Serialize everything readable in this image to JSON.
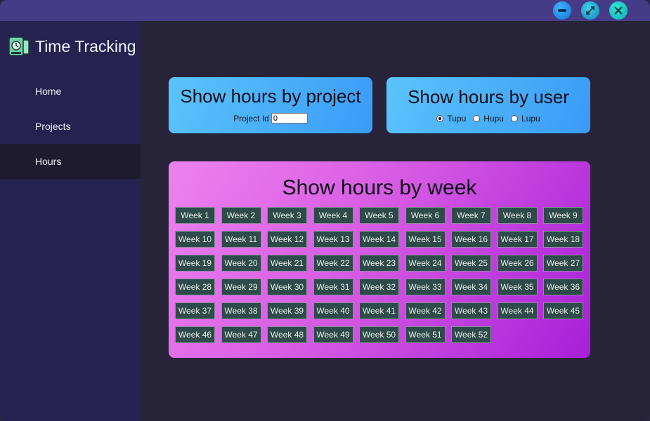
{
  "app": {
    "title": "Time Tracking",
    "icon": "time-tracking-logo-icon"
  },
  "window_controls": {
    "minimize_icon": "minimize-icon",
    "maximize_icon": "maximize-icon",
    "close_icon": "close-icon"
  },
  "sidebar": {
    "items": [
      {
        "label": "Home",
        "active": false
      },
      {
        "label": "Projects",
        "active": false
      },
      {
        "label": "Hours",
        "active": true
      }
    ]
  },
  "project_card": {
    "title": "Show hours by project",
    "input_label": "Project Id",
    "input_value": "0"
  },
  "user_card": {
    "title": "Show hours by user",
    "options": [
      {
        "label": "Tupu",
        "checked": true
      },
      {
        "label": "Hupu",
        "checked": false
      },
      {
        "label": "Lupu",
        "checked": false
      }
    ]
  },
  "week_card": {
    "title": "Show hours by week",
    "weeks": [
      "Week 1",
      "Week 2",
      "Week 3",
      "Week 4",
      "Week 5",
      "Week 6",
      "Week 7",
      "Week 8",
      "Week 9",
      "Week 10",
      "Week 11",
      "Week 12",
      "Week 13",
      "Week 14",
      "Week 15",
      "Week 16",
      "Week 17",
      "Week 18",
      "Week 19",
      "Week 20",
      "Week 21",
      "Week 22",
      "Week 23",
      "Week 24",
      "Week 25",
      "Week 26",
      "Week 27",
      "Week 28",
      "Week 29",
      "Week 30",
      "Week 31",
      "Week 32",
      "Week 33",
      "Week 34",
      "Week 35",
      "Week 36",
      "Week 37",
      "Week 38",
      "Week 39",
      "Week 40",
      "Week 41",
      "Week 42",
      "Week 43",
      "Week 44",
      "Week 45",
      "Week 46",
      "Week 47",
      "Week 48",
      "Week 49",
      "Week 50",
      "Week 51",
      "Week 52"
    ]
  },
  "colors": {
    "titlebar": "#463b86",
    "sidebar": "#252250",
    "sidebar_active": "#1e1b2e",
    "content_bg": "#27243a",
    "blue_card": "#4aaef9",
    "week_card": "#d65be3",
    "week_button": "#2f4a4a"
  }
}
